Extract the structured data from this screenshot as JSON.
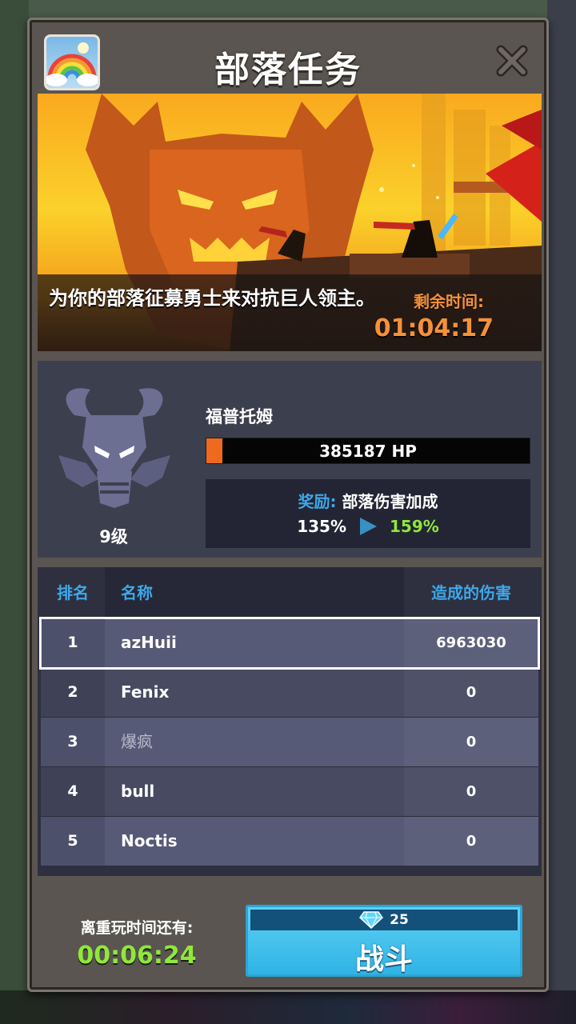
{
  "dialog": {
    "title": "部落任务",
    "close_icon": "close-icon",
    "badge_icon": "rainbow-icon"
  },
  "banner": {
    "description": "为你的部落征募勇士来对抗巨人领主。",
    "time_label": "剩余时间:",
    "time_value": "01:04:17"
  },
  "boss": {
    "icon": "demon-boss-icon",
    "level": "9级",
    "name": "福普托姆",
    "hp_text": "385187 HP",
    "hp_fraction": 0.05,
    "reward_label": "奖励:",
    "reward_text": "部落伤害加成",
    "reward_from": "135%",
    "reward_to": "159%"
  },
  "leaderboard": {
    "headers": {
      "rank": "排名",
      "name": "名称",
      "damage": "造成的伤害"
    },
    "rows": [
      {
        "rank": "1",
        "name": "azHuii",
        "damage": "6963030",
        "selected": true
      },
      {
        "rank": "2",
        "name": "Fenix",
        "damage": "0"
      },
      {
        "rank": "3",
        "name": "爆疯",
        "damage": "0"
      },
      {
        "rank": "4",
        "name": "bull",
        "damage": "0"
      },
      {
        "rank": "5",
        "name": "Noctis",
        "damage": "0"
      }
    ]
  },
  "footer": {
    "replay_label": "离重玩时间还有:",
    "replay_time": "00:06:24",
    "fight_cost": "25",
    "fight_cost_icon": "diamond-icon",
    "fight_label": "战斗"
  },
  "colors": {
    "accent_blue": "#3ea8e8",
    "accent_orange": "#f5913a",
    "accent_green": "#8fe83a",
    "hp_fill": "#ef6a1f"
  }
}
